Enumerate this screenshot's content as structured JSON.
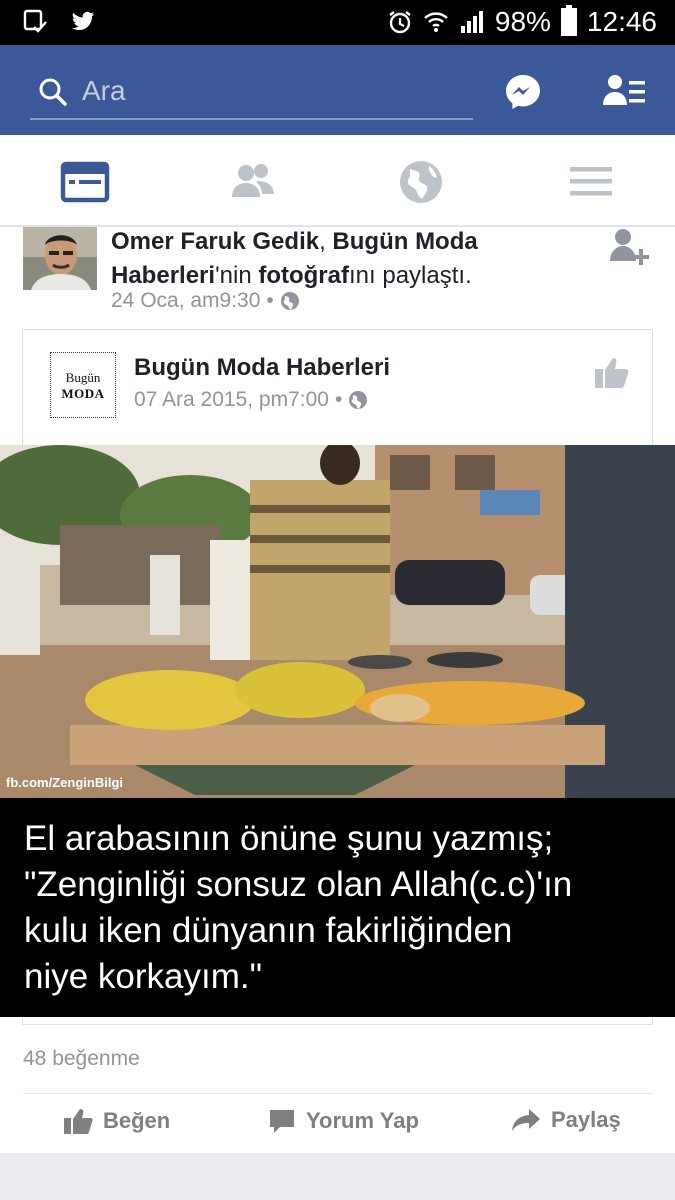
{
  "status_bar": {
    "battery": "98%",
    "battery_level": 0.98,
    "time": "12:46"
  },
  "header": {
    "search_placeholder": "Ara"
  },
  "shared_post": {
    "sharer": "Omer Faruk Gedik",
    "page": "Bugün Moda Haberleri",
    "text_possessive": "'nin ",
    "object": "fotoğraf",
    "text_suffix": "ını paylaştı.",
    "separator": ", ",
    "timestamp": "24 Oca, am9:30",
    "dot": "•"
  },
  "original_post": {
    "logo_line1": "Bugün",
    "logo_line2": "MODA",
    "page_name": "Bugün Moda Haberleri",
    "timestamp": "07 Ara 2015, pm7:00",
    "dot": "•",
    "watermark": "fb.com/ZenginBilgi",
    "caption": [
      "El arabasının önüne şunu yazmış;",
      "\"Zenginliği sonsuz olan Allah(c.c)'ın",
      "kulu iken dünyanın fakirliğinden",
      "niye korkayım.\""
    ]
  },
  "engagement": {
    "likes_label": "48 beğenme"
  },
  "actions": {
    "like": "Beğen",
    "comment": "Yorum Yap",
    "share": "Paylaş"
  },
  "colors": {
    "brand": "#3b5998",
    "tab_active": "#3b5998",
    "tab_inactive": "#bec3c9",
    "meta_text": "#90949c"
  }
}
